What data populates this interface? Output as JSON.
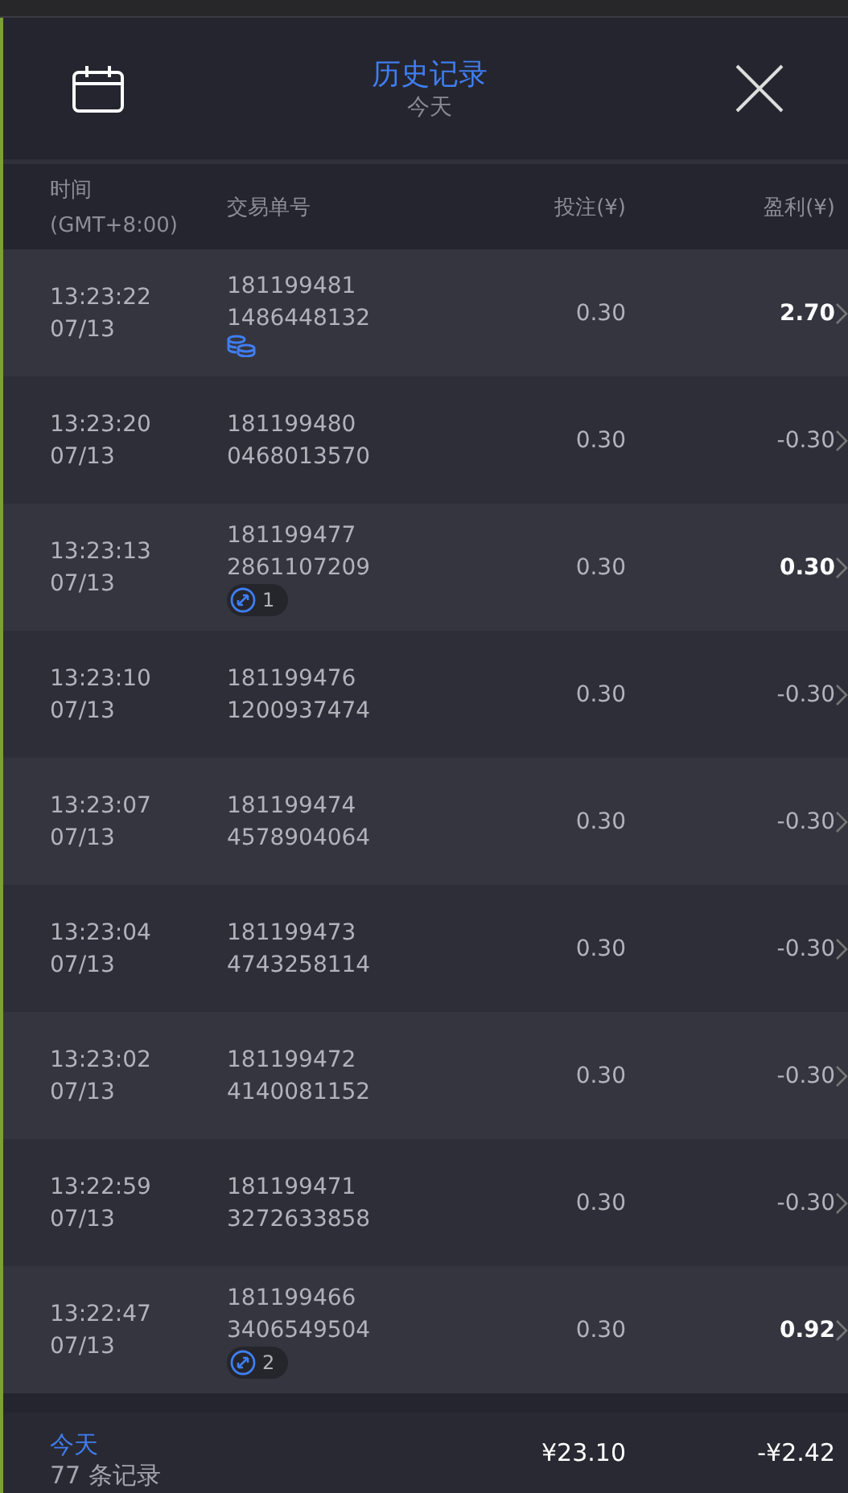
{
  "header": {
    "title": "历史记录",
    "subtitle": "今天"
  },
  "columns": {
    "time": "时间",
    "time_zone": "(GMT+8:00)",
    "order": "交易单号",
    "stake": "投注(¥)",
    "profit": "盈利(¥)"
  },
  "rows": [
    {
      "time": "13:23:22",
      "date": "07/13",
      "order_1": "181199481",
      "order_2": "1486448132",
      "badge": {
        "kind": "coins"
      },
      "stake": "0.30",
      "profit": "2.70",
      "win": true
    },
    {
      "time": "13:23:20",
      "date": "07/13",
      "order_1": "181199480",
      "order_2": "0468013570",
      "stake": "0.30",
      "profit": "-0.30",
      "win": false
    },
    {
      "time": "13:23:13",
      "date": "07/13",
      "order_1": "181199477",
      "order_2": "2861107209",
      "badge": {
        "kind": "count",
        "text": "1"
      },
      "stake": "0.30",
      "profit": "0.30",
      "win": true
    },
    {
      "time": "13:23:10",
      "date": "07/13",
      "order_1": "181199476",
      "order_2": "1200937474",
      "stake": "0.30",
      "profit": "-0.30",
      "win": false
    },
    {
      "time": "13:23:07",
      "date": "07/13",
      "order_1": "181199474",
      "order_2": "4578904064",
      "stake": "0.30",
      "profit": "-0.30",
      "win": false
    },
    {
      "time": "13:23:04",
      "date": "07/13",
      "order_1": "181199473",
      "order_2": "4743258114",
      "stake": "0.30",
      "profit": "-0.30",
      "win": false
    },
    {
      "time": "13:23:02",
      "date": "07/13",
      "order_1": "181199472",
      "order_2": "4140081152",
      "stake": "0.30",
      "profit": "-0.30",
      "win": false
    },
    {
      "time": "13:22:59",
      "date": "07/13",
      "order_1": "181199471",
      "order_2": "3272633858",
      "stake": "0.30",
      "profit": "-0.30",
      "win": false
    },
    {
      "time": "13:22:47",
      "date": "07/13",
      "order_1": "181199466",
      "order_2": "3406549504",
      "badge": {
        "kind": "count",
        "text": "2"
      },
      "stake": "0.30",
      "profit": "0.92",
      "win": true
    }
  ],
  "footer": {
    "period": "今天",
    "count": "77 条记录",
    "stake_total": "¥23.10",
    "profit_total": "-¥2.42"
  }
}
